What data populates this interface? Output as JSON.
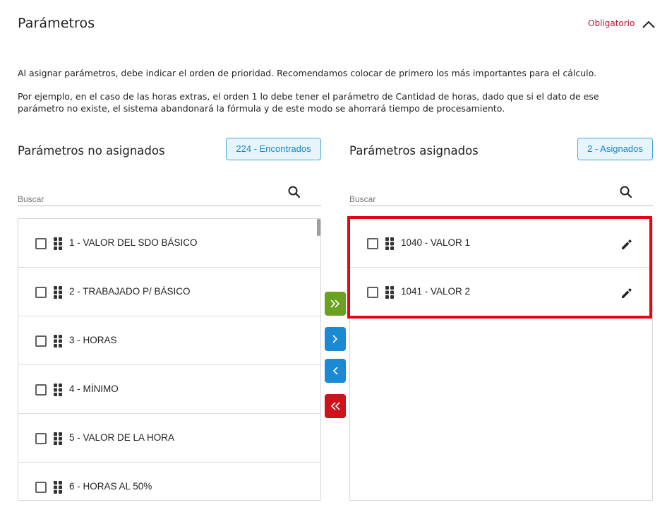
{
  "header": {
    "title": "Parámetros",
    "required_label": "Obligatorio"
  },
  "description": {
    "line1": "Al asignar parámetros, debe indicar el orden de prioridad. Recomendamos colocar de primero los más importantes para el cálculo.",
    "line2": "Por ejemplo, en el caso de las horas extras, el orden 1 lo debe tener el parámetro de Cantidad de horas, dado que si el dato de ese parámetro no existe, el sistema abandonará la fórmula y de este modo se ahorrará tiempo de procesamiento."
  },
  "unassigned": {
    "title": "Parámetros no asignados",
    "count_badge": "224 - Encontrados",
    "search_placeholder": "Buscar",
    "items": [
      {
        "label": "1 - VALOR DEL SDO BÁSICO"
      },
      {
        "label": "2 - TRABAJADO P/ BÁSICO"
      },
      {
        "label": "3 - HORAS"
      },
      {
        "label": "4 - MÍNIMO"
      },
      {
        "label": "5 - VALOR DE LA HORA"
      },
      {
        "label": "6 - HORAS AL 50%"
      }
    ]
  },
  "assigned": {
    "title": "Parámetros asignados",
    "count_badge": "2 - Asignados",
    "search_placeholder": "Buscar",
    "items": [
      {
        "label": "1040 - VALOR 1"
      },
      {
        "label": "1041 - VALOR 2"
      }
    ]
  },
  "move_buttons": [
    {
      "icon": "double-chevron-right-icon",
      "color": "#6aa121"
    },
    {
      "icon": "chevron-right-icon",
      "color": "#1a8ad4"
    },
    {
      "icon": "chevron-left-icon",
      "color": "#1a8ad4"
    },
    {
      "icon": "double-chevron-left-icon",
      "color": "#d0111b"
    }
  ],
  "colors": {
    "accent_blue": "#1a86c8",
    "required_red": "#c0122a",
    "highlight_red": "#e30613"
  }
}
